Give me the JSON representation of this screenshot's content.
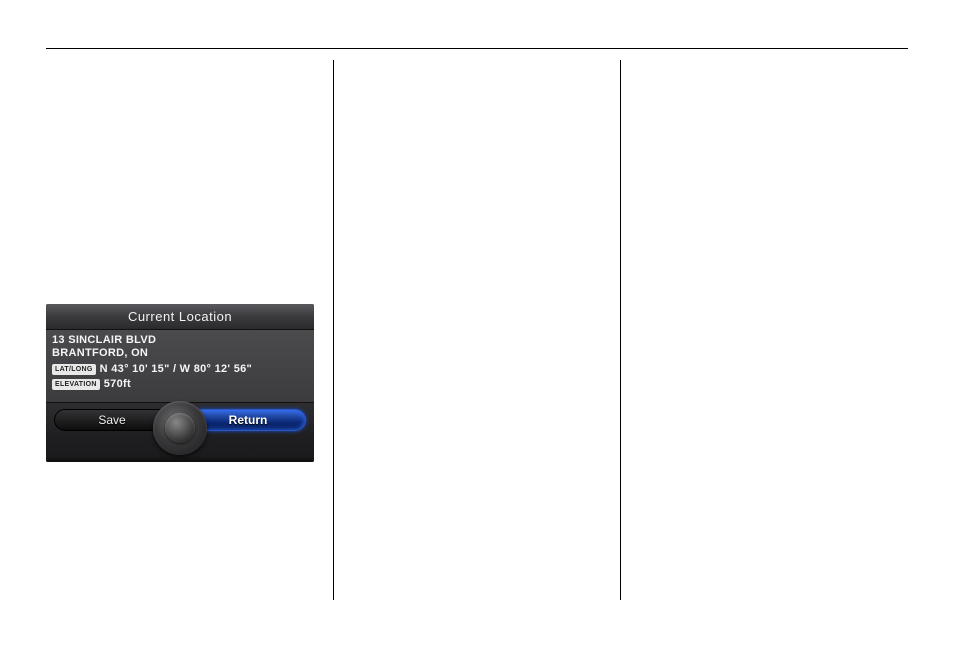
{
  "screen": {
    "title": "Current Location",
    "address_line1": "13 SINCLAIR BLVD",
    "address_line2": "BRANTFORD, ON",
    "latlong_label": "LAT/LONG",
    "latlong_value": "N 43° 10' 15\" / W 80° 12' 56\"",
    "elevation_label": "ELEVATION",
    "elevation_value": "570ft",
    "save_label": "Save",
    "return_label": "Return"
  }
}
